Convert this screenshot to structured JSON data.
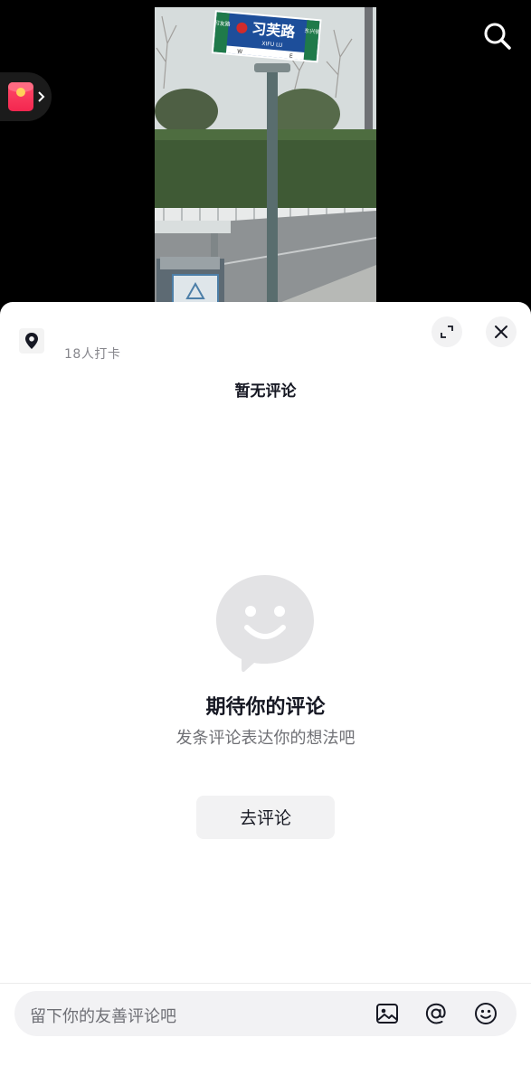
{
  "top": {
    "search_icon": "search-icon",
    "redpacket_icon": "red-packet-icon"
  },
  "video": {
    "sign": {
      "main": "习芙路",
      "pinyin": "XIFU LU",
      "left_side": "习友路",
      "right_side": "东兴街",
      "dir_west": "W",
      "dir_east": "E"
    }
  },
  "sheet": {
    "checkin_text": "18人打卡",
    "no_comments": "暂无评论",
    "empty_title": "期待你的评论",
    "empty_subtitle": "发条评论表达你的想法吧",
    "go_comment_label": "去评论"
  },
  "comment_bar": {
    "placeholder": "留下你的友善评论吧",
    "icons": [
      "image-icon",
      "at-icon",
      "emoji-icon"
    ]
  }
}
